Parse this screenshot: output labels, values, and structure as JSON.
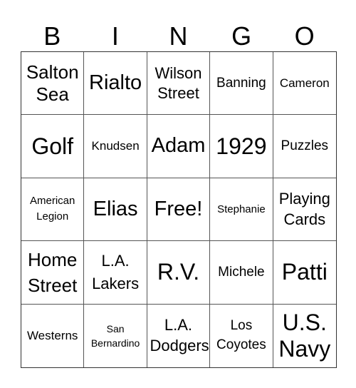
{
  "header": {
    "letters": [
      "B",
      "I",
      "N",
      "G",
      "O"
    ]
  },
  "card": {
    "rows": [
      [
        "Salton Sea",
        "Rialto",
        "Wilson Street",
        "Banning",
        "Cameron"
      ],
      [
        "Golf",
        "Knudsen",
        "Adam",
        "1929",
        "Puzzles"
      ],
      [
        "American Legion",
        "Elias",
        "Free!",
        "Stephanie",
        "Playing Cards"
      ],
      [
        "Home Street",
        "L.A. Lakers",
        "R.V.",
        "Michele",
        "Patti"
      ],
      [
        "Westerns",
        "San Bernardino",
        "L.A. Dodgers",
        "Los Coyotes",
        "U.S. Navy"
      ]
    ],
    "free_space": "Free!"
  }
}
